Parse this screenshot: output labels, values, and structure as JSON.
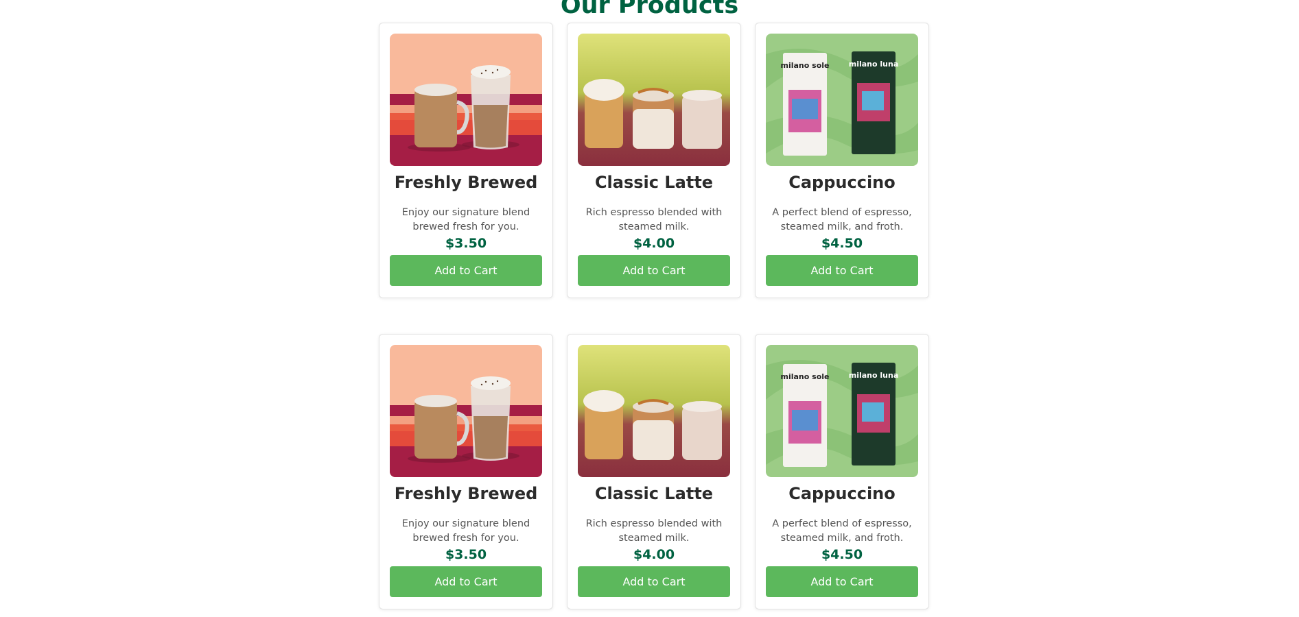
{
  "section": {
    "title": "Our Products"
  },
  "colors": {
    "brand_green": "#006241",
    "button_green": "#5cb85c"
  },
  "products": [
    {
      "name": "Freshly Brewed",
      "description": "Enjoy our signature blend brewed fresh for you.",
      "price": "$3.50",
      "button_label": "Add to Cart",
      "image": "brewed-coffee-image"
    },
    {
      "name": "Classic Latte",
      "description": "Rich espresso blended with steamed milk.",
      "price": "$4.00",
      "button_label": "Add to Cart",
      "image": "latte-trio-image"
    },
    {
      "name": "Cappuccino",
      "description": "A perfect blend of espresso, steamed milk, and froth.",
      "price": "$4.50",
      "button_label": "Add to Cart",
      "image": "coffee-bags-image",
      "bag_labels": [
        "milano sole",
        "milano luna"
      ]
    },
    {
      "name": "Freshly Brewed",
      "description": "Enjoy our signature blend brewed fresh for you.",
      "price": "$3.50",
      "button_label": "Add to Cart",
      "image": "brewed-coffee-image"
    },
    {
      "name": "Classic Latte",
      "description": "Rich espresso blended with steamed milk.",
      "price": "$4.00",
      "button_label": "Add to Cart",
      "image": "latte-trio-image"
    },
    {
      "name": "Cappuccino",
      "description": "A perfect blend of espresso, steamed milk, and froth.",
      "price": "$4.50",
      "button_label": "Add to Cart",
      "image": "coffee-bags-image",
      "bag_labels": [
        "milano sole",
        "milano luna"
      ]
    }
  ]
}
